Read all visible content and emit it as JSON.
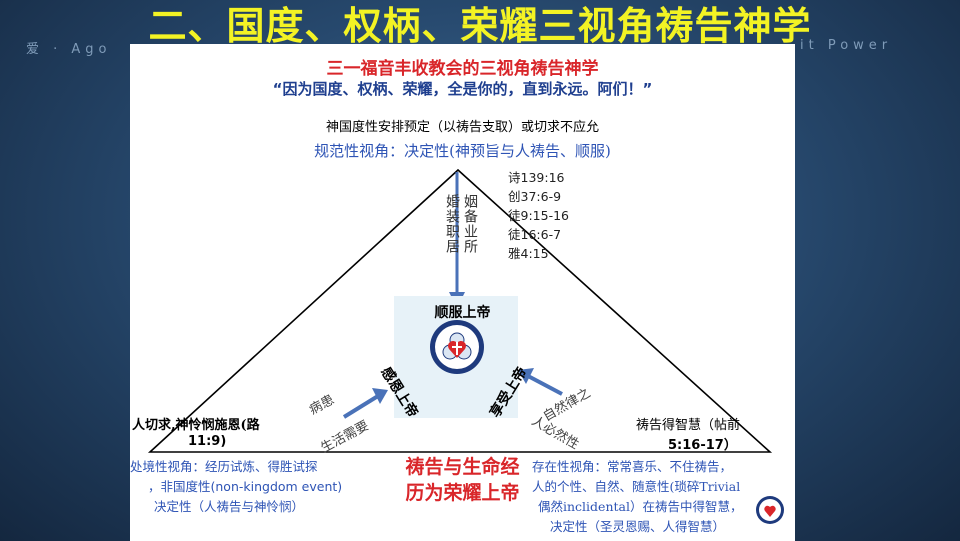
{
  "slide": {
    "title": "二、国度、权柄、荣耀三视角祷告神学",
    "bg_left": "爱 · Ago",
    "bg_right": "it Power"
  },
  "diagram": {
    "church_title": "三一福音丰收教会的三视角祷告神学",
    "verse": "“因为国度、权柄、荣耀，全是你的，直到永远。阿们！”",
    "kingdom_line": "神国度性安排预定（以祷告支取）或切求不应允",
    "normative": "规范性视角：决定性(神预旨与人祷告、顺服)",
    "refs": [
      "诗139:16",
      "创37:6-9",
      "徒9:15-16",
      "徒16:6-7",
      "雅4:15"
    ],
    "top_col1": "婚装职居",
    "top_col2": "姻备业所",
    "center": {
      "obey": "顺服上帝",
      "thank": "感恩上帝",
      "enjoy": "享受上帝"
    },
    "left_arrow_upper": "病患",
    "left_arrow_lower": "生活需要",
    "right_arrow_upper": "自然律之",
    "right_arrow_lower": "人必然性",
    "left_corner": {
      "title": "人切求,神怜悯施恩(路",
      "ref": "11:9)",
      "line1": "处境性视角：经历试炼、得胜试探",
      "line2": "，非国度性(non-kingdom event)",
      "line3": "决定性（人祷告与神怜悯）"
    },
    "main_bottom": {
      "line1": "祷告与生命经",
      "line2": "历为荣耀上帝"
    },
    "right_corner": {
      "title": "祷告得智慧（帖前",
      "ref": "5:16-17）",
      "line1": "存在性视角：常常喜乐、不住祷告，",
      "line2": "人的个性、自然、随意性(琐碎Trivial",
      "line3": "偶然inclidental）在祷告中得智慧，",
      "line4": "决定性（圣灵恩赐、人得智慧）"
    },
    "colors": {
      "title_yellow": "#f3f324",
      "red": "#d9262a",
      "blue_text": "#2e54b5",
      "arrow_blue": "#4a72b8",
      "logo_navy": "#1e3a7d"
    }
  }
}
